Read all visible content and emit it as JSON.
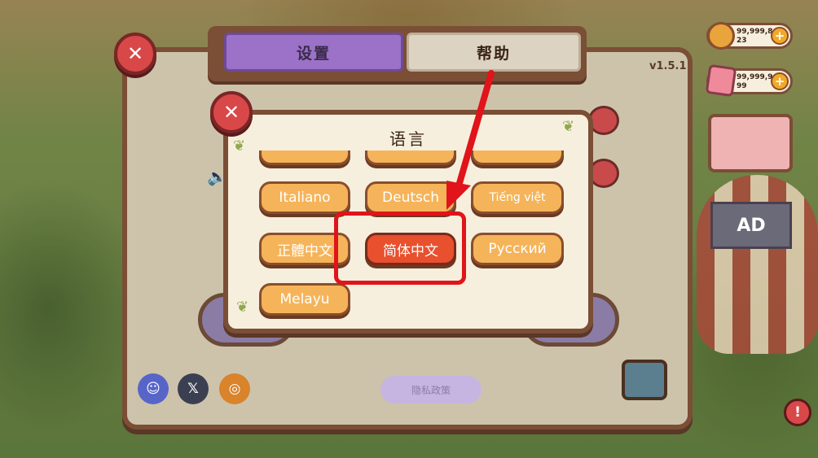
{
  "tabs": {
    "settings": "设置",
    "help": "帮助"
  },
  "version": "v1.5.1",
  "language_dialog": {
    "title": "语言",
    "languages": [
      {
        "label": "Italiano",
        "selected": false
      },
      {
        "label": "Deutsch",
        "selected": false
      },
      {
        "label": "Tiếng việt",
        "selected": false
      },
      {
        "label": "正體中文",
        "selected": false
      },
      {
        "label": "简体中文",
        "selected": true
      },
      {
        "label": "Русский",
        "selected": false
      },
      {
        "label": "Melayu",
        "selected": false
      }
    ]
  },
  "privacy_button": "隐私政策",
  "currency": {
    "coins": "99,999,8\n23",
    "gems": "99,999,9\n99"
  },
  "ad_sign": "AD",
  "icons": {
    "close": "close-icon",
    "discord": "discord-icon",
    "x": "x-icon",
    "instagram": "instagram-icon",
    "plus": "plus-icon",
    "coin": "coin-icon",
    "gem": "gem-icon",
    "alert": "alert-icon",
    "speaker": "speaker-icon",
    "chest": "treasure-chest-icon"
  },
  "colors": {
    "highlight": "#e0141a",
    "selected_language": "#e8502e",
    "language_button": "#f5b45a",
    "settings_tab": "#9b72c7"
  }
}
